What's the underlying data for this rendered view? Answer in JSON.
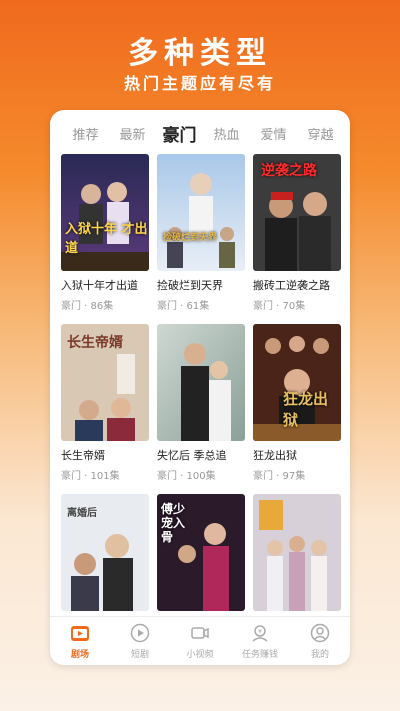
{
  "hero": {
    "title": "多种类型",
    "subtitle": "热门主题应有尽有"
  },
  "tabs": [
    {
      "label": "推荐"
    },
    {
      "label": "最新"
    },
    {
      "label": "豪门"
    },
    {
      "label": "热血"
    },
    {
      "label": "爱情"
    },
    {
      "label": "穿越"
    }
  ],
  "active_tab": "豪门",
  "dramas": [
    {
      "title": "入狱十年才出道",
      "meta": "豪门 · 86集",
      "poster_text": "入狱十年 才出道"
    },
    {
      "title": "捡破烂到天界",
      "meta": "豪门 · 61集",
      "poster_text": "捡破烂到天界"
    },
    {
      "title": "搬砖工逆袭之路",
      "meta": "豪门 · 70集",
      "poster_text": "逆袭之路"
    },
    {
      "title": "长生帝婿",
      "meta": "豪门 · 101集",
      "poster_text": "长生帝婿"
    },
    {
      "title": "失忆后 季总追",
      "meta": "豪门 · 100集",
      "poster_text": ""
    },
    {
      "title": "狂龙出狱",
      "meta": "豪门 · 97集",
      "poster_text": "狂龙出狱"
    },
    {
      "title": "",
      "meta": "",
      "poster_text": "离婚后"
    },
    {
      "title": "",
      "meta": "",
      "poster_text": "傅少宠入骨"
    },
    {
      "title": "",
      "meta": "",
      "poster_text": ""
    }
  ],
  "bottom_nav": [
    {
      "label": "剧场",
      "icon": "theater-icon",
      "active": true
    },
    {
      "label": "短剧",
      "icon": "play-icon",
      "active": false
    },
    {
      "label": "小视频",
      "icon": "video-icon",
      "active": false
    },
    {
      "label": "任务赚钱",
      "icon": "task-icon",
      "active": false
    },
    {
      "label": "我的",
      "icon": "profile-icon",
      "active": false
    }
  ],
  "colors": {
    "accent": "#f06a1e"
  }
}
